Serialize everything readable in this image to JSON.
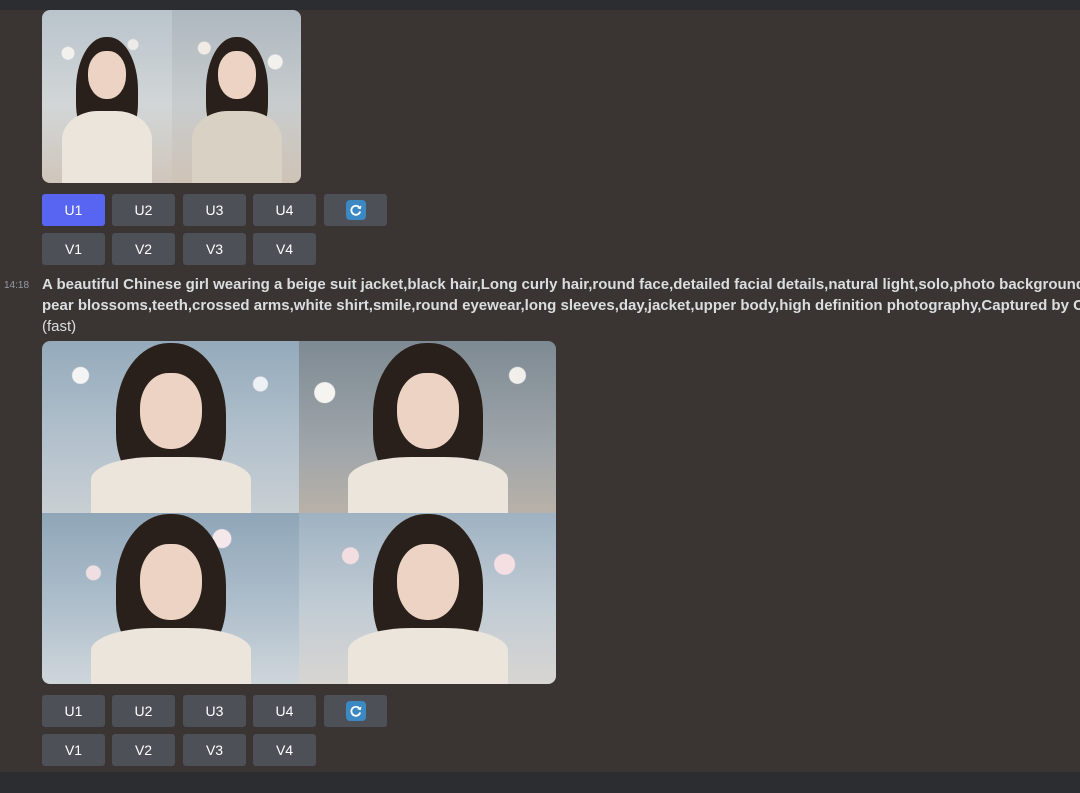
{
  "message_1": {
    "buttons_upscale": [
      "U1",
      "U2",
      "U3",
      "U4"
    ],
    "buttons_variation": [
      "V1",
      "V2",
      "V3",
      "V4"
    ],
    "refresh_icon": "refresh-icon"
  },
  "message_2": {
    "timestamp": "14:18",
    "prompt_line_1": "A beautiful Chinese girl wearing a beige suit jacket,black hair,Long curly hair,round face,detailed facial details,natural light,solo,photo background,ou",
    "prompt_line_2": "pear blossoms,teeth,crossed arms,white shirt,smile,round eyewear,long sleeves,day,jacket,upper body,high definition photography,Captured by Canor",
    "prompt_suffix": "(fast)",
    "buttons_upscale": [
      "U1",
      "U2",
      "U3",
      "U4"
    ],
    "buttons_variation": [
      "V1",
      "V2",
      "V3",
      "V4"
    ],
    "refresh_icon": "refresh-icon"
  },
  "colors": {
    "background": "#3a3532",
    "button": "#4e5058",
    "button_selected": "#5865f2",
    "refresh_icon": "#3b88c3"
  }
}
